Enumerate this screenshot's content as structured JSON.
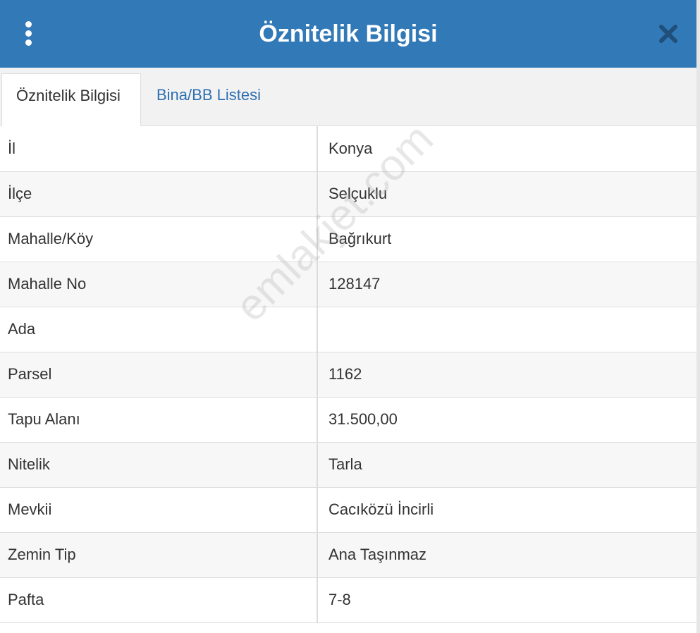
{
  "window": {
    "title": "Öznitelik Bilgisi",
    "menu_icon": "vertical-ellipsis-icon",
    "close_icon": "close-x-icon",
    "accent_color": "#3279b8"
  },
  "tabs": [
    {
      "label": "Öznitelik Bilgisi",
      "active": true
    },
    {
      "label": "Bina/BB Listesi",
      "active": false
    }
  ],
  "attributes": [
    {
      "label": "İl",
      "value": "Konya"
    },
    {
      "label": "İlçe",
      "value": "Selçuklu"
    },
    {
      "label": "Mahalle/Köy",
      "value": "Bağrıkurt"
    },
    {
      "label": "Mahalle No",
      "value": "128147"
    },
    {
      "label": "Ada",
      "value": ""
    },
    {
      "label": "Parsel",
      "value": "1162"
    },
    {
      "label": "Tapu Alanı",
      "value": "31.500,00"
    },
    {
      "label": "Nitelik",
      "value": "Tarla"
    },
    {
      "label": "Mevkii",
      "value": "Cacıközü İncirli"
    },
    {
      "label": "Zemin Tip",
      "value": "Ana Taşınmaz"
    },
    {
      "label": "Pafta",
      "value": "7-8"
    }
  ],
  "watermark": "emlakjet.com"
}
